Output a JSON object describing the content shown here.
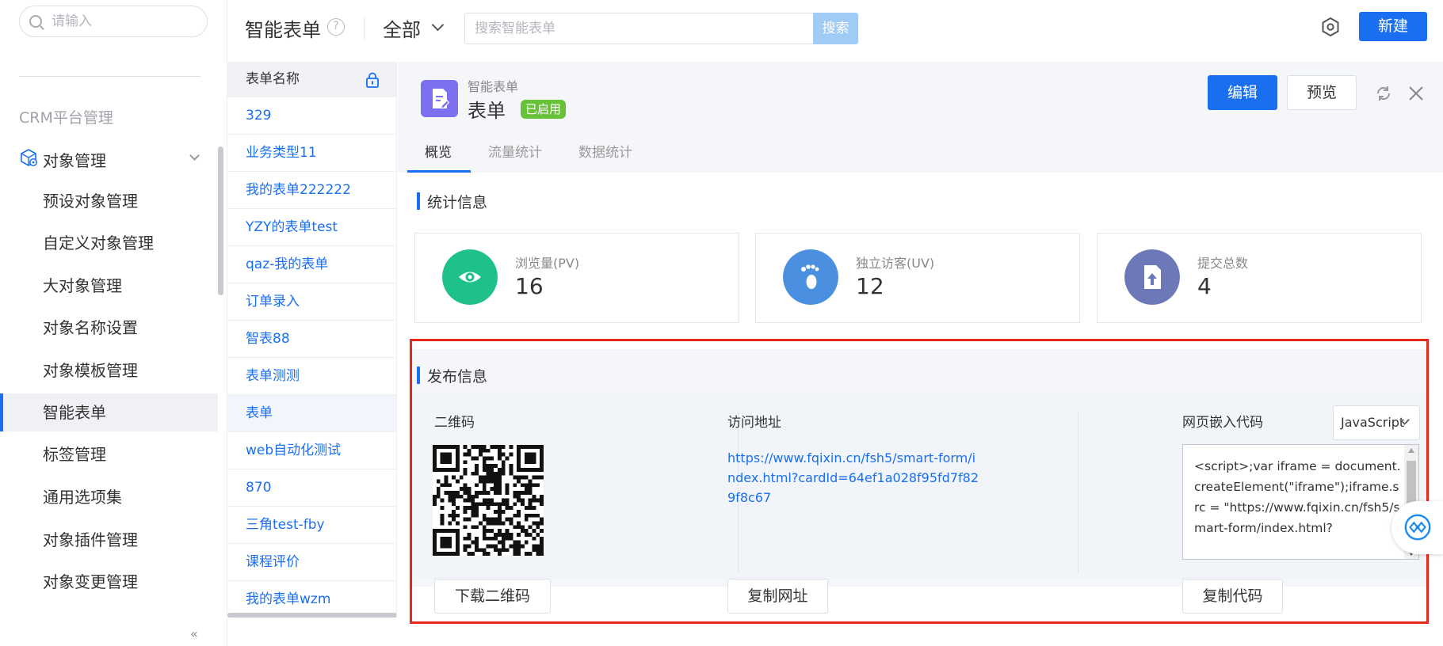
{
  "sidebar": {
    "search_placeholder": "请输入",
    "group_label": "CRM平台管理",
    "parent_label": "对象管理",
    "items": [
      {
        "label": "预设对象管理"
      },
      {
        "label": "自定义对象管理"
      },
      {
        "label": "大对象管理"
      },
      {
        "label": "对象名称设置"
      },
      {
        "label": "对象模板管理"
      },
      {
        "label": "智能表单"
      },
      {
        "label": "标签管理"
      },
      {
        "label": "通用选项集"
      },
      {
        "label": "对象插件管理"
      },
      {
        "label": "对象变更管理"
      }
    ],
    "active_item": "智能表单",
    "collapse_glyph": "«"
  },
  "header": {
    "title": "智能表单",
    "help_glyph": "?",
    "scope": "全部",
    "search_placeholder": "搜索智能表单",
    "search_button": "搜索",
    "new_button": "新建"
  },
  "form_list": {
    "column_header": "表单名称",
    "items": [
      "329",
      "业务类型11",
      "我的表单222222",
      "YZY的表单test",
      "qaz-我的表单",
      "订单录入",
      "智表88",
      "表单测测",
      "表单",
      "web自动化测试",
      "870",
      "三角test-fby",
      "课程评价",
      "我的表单wzm"
    ],
    "active_item": "表单"
  },
  "detail": {
    "subtitle": "智能表单",
    "title": "表单",
    "status_badge": "已启用",
    "edit_button": "编辑",
    "preview_button": "预览",
    "tabs": [
      {
        "label": "概览",
        "active": true
      },
      {
        "label": "流量统计",
        "active": false
      },
      {
        "label": "数据统计",
        "active": false
      }
    ],
    "stats_section_title": "统计信息",
    "stats": [
      {
        "label": "浏览量(PV)",
        "value": "16",
        "color": "#1fc18a",
        "icon": "eye-icon"
      },
      {
        "label": "独立访客(UV)",
        "value": "12",
        "color": "#4a8fe0",
        "icon": "footprint-icon"
      },
      {
        "label": "提交总数",
        "value": "4",
        "color": "#6c78b8",
        "icon": "file-upload-icon"
      }
    ],
    "publish": {
      "section_title": "发布信息",
      "qrcode_label": "二维码",
      "download_qr_button": "下载二维码",
      "url_label": "访问地址",
      "url": "https://www.fqixin.cn/fsh5/smart-form/index.html?cardId=64ef1a028f95fd7f829f8c67",
      "copy_url_button": "复制网址",
      "embed_label": "网页嵌入代码",
      "embed_language": "JavaScript",
      "embed_code": "<script>;var iframe = document.createElement(\"iframe\");iframe.src = \"https://www.fqixin.cn/fsh5/smart-form/index.html?",
      "copy_code_button": "复制代码"
    }
  },
  "colors": {
    "accent": "#1a6ff0",
    "enabled_badge": "#67c23a",
    "highlight_border": "#e8281c",
    "form_icon": "#7c6ff0"
  }
}
